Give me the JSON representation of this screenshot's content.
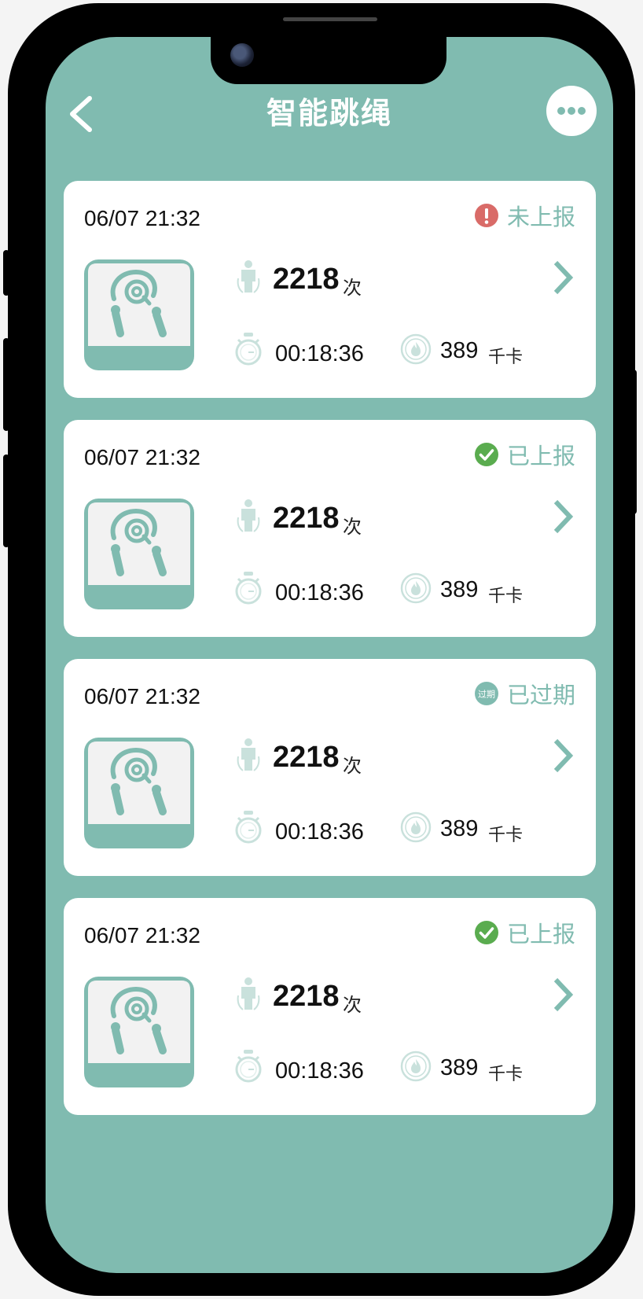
{
  "header": {
    "title": "智能跳绳",
    "back_icon": "chevron-left-icon",
    "more_icon": "more-dots-icon"
  },
  "colors": {
    "accent": "#80bbb0",
    "status_error": "#d96b68",
    "status_ok": "#5aac4f",
    "status_expired": "#80bbb0"
  },
  "records": [
    {
      "datetime": "06/07 21:32",
      "status": "未上报",
      "status_icon": "warning-icon",
      "count": "2218",
      "count_unit": "次",
      "duration": "00:18:36",
      "calories": "389",
      "calories_unit": "千卡"
    },
    {
      "datetime": "06/07 21:32",
      "status": "已上报",
      "status_icon": "check-icon",
      "count": "2218",
      "count_unit": "次",
      "duration": "00:18:36",
      "calories": "389",
      "calories_unit": "千卡"
    },
    {
      "datetime": "06/07 21:32",
      "status": "已过期",
      "status_icon": "expired-badge-icon",
      "status_badge_text": "过期",
      "count": "2218",
      "count_unit": "次",
      "duration": "00:18:36",
      "calories": "389",
      "calories_unit": "千卡"
    },
    {
      "datetime": "06/07 21:32",
      "status": "已上报",
      "status_icon": "check-icon",
      "count": "2218",
      "count_unit": "次",
      "duration": "00:18:36",
      "calories": "389",
      "calories_unit": "千卡"
    }
  ]
}
